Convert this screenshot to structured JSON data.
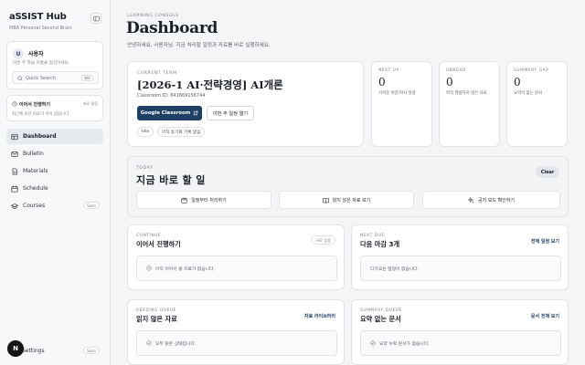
{
  "sidebar": {
    "brand": "aSSIST Hub",
    "brand_sub": "MBA Personal Second Brain",
    "user": {
      "initial": "U",
      "name": "사용자",
      "sub": "이번 주 학습 흐름을 점검하세요.",
      "search_placeholder": "Quick Search",
      "search_kbd": "⌘K"
    },
    "continue": {
      "title": "이어서 진행하기",
      "badge": "바로 읽음",
      "sub": "최근에 보던 자료가 아직 없습니다."
    },
    "nav": [
      {
        "label": "Dashboard",
        "icon": "grid-icon",
        "active": true
      },
      {
        "label": "Bulletin",
        "icon": "mail-icon"
      },
      {
        "label": "Materials",
        "icon": "file-icon"
      },
      {
        "label": "Schedule",
        "icon": "calendar-icon"
      },
      {
        "label": "Courses",
        "icon": "graduation-cap-icon",
        "badge": "Soon"
      }
    ],
    "settings": {
      "label": "Settings",
      "badge": "Soon"
    },
    "floating_badge": "N"
  },
  "header": {
    "eyebrow": "Learning Console",
    "title": "Dashboard",
    "description": "안녕하세요, 사용자님. 지금 처리할 일정과 자료를 바로 실행하세요."
  },
  "term": {
    "eyebrow": "Current Term",
    "title": "[2026-1 AI·전략경영] AI개론",
    "classroom_id": "Classroom ID: 841669156744",
    "gc_button": "Google Classroom",
    "week_button": "이번 주 일정 열기",
    "chips": [
      "Idle",
      "아직 동기화 기록 없음"
    ]
  },
  "stats": [
    {
      "eyebrow": "Next Up",
      "value": "0",
      "desc": "가까운 마감/학사 일정"
    },
    {
      "eyebrow": "Unread",
      "value": "0",
      "desc": "아직 열람하지 않은 자료"
    },
    {
      "eyebrow": "Summary Gap",
      "value": "0",
      "desc": "요약이 없는 문서"
    }
  ],
  "today": {
    "eyebrow": "Today",
    "title": "지금 바로 할 일",
    "clear": "Clear",
    "actions": [
      {
        "label": "일정부터 처리하기",
        "icon": "calendar-icon"
      },
      {
        "label": "읽지 않은 자료 보기",
        "icon": "book-icon"
      },
      {
        "label": "공지 보드 확인하기",
        "icon": "sparkle-icon"
      }
    ]
  },
  "panels": {
    "continue": {
      "eyebrow": "Continue",
      "title": "이어서 진행하기",
      "tag": "바로 읽음",
      "empty": "아직 이어서 볼 자료가 없습니다."
    },
    "next_due": {
      "eyebrow": "Next Due",
      "title": "다음 마감 3개",
      "link": "전체 일정 보기",
      "empty": "다가오는 일정이 없습니다."
    },
    "reading": {
      "eyebrow": "Reading Queue",
      "title": "읽지 않은 자료",
      "link": "자료 라이브러리",
      "empty": "모두 읽은 상태입니다."
    },
    "summary": {
      "eyebrow": "Summary Queue",
      "title": "요약 없는 문서",
      "link": "문서 전체 보기",
      "empty": "요약 누락 문서가 없습니다."
    }
  }
}
